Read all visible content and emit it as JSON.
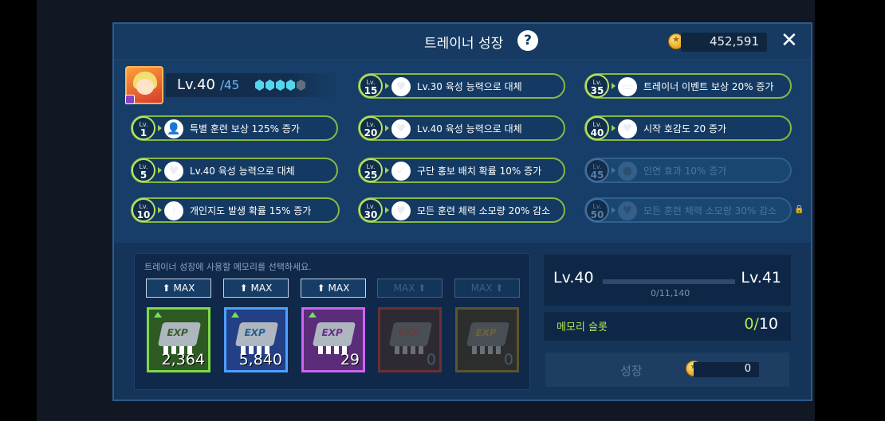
{
  "header": {
    "title": "트레이너 성장",
    "help_glyph": "?",
    "gold": "452,591",
    "close_glyph": "✕"
  },
  "trainer": {
    "level": "Lv.40",
    "max_level": "/45",
    "gems_filled": 4,
    "gems_total": 5
  },
  "perks": [
    {
      "lv_prefix": "Lv.",
      "lv": "1",
      "icon": "trainer-plus-icon",
      "glyph": "👤",
      "text": "특별 훈련 보상 125% 증가",
      "locked": false
    },
    {
      "lv_prefix": "Lv.",
      "lv": "5",
      "icon": "heart-icon",
      "glyph": "♥",
      "text": "Lv.40 육성 능력으로 대체",
      "locked": false
    },
    {
      "lv_prefix": "Lv.",
      "lv": "10",
      "icon": "alert-icon",
      "glyph": "!",
      "text": "개인지도 발생 확률 15% 증가",
      "locked": false
    },
    {
      "lv_prefix": "Lv.",
      "lv": "15",
      "icon": "broken-heart-icon",
      "glyph": "♥",
      "text": "Lv.30 육성 능력으로 대체",
      "locked": false
    },
    {
      "lv_prefix": "Lv.",
      "lv": "20",
      "icon": "heart-icon",
      "glyph": "♥",
      "text": "Lv.40 육성 능력으로 대체",
      "locked": false
    },
    {
      "lv_prefix": "Lv.",
      "lv": "25",
      "icon": "person-check-icon",
      "glyph": "✓",
      "text": "구단 홍보 배치 확률 10% 증가",
      "locked": false
    },
    {
      "lv_prefix": "Lv.",
      "lv": "30",
      "icon": "broken-heart-icon",
      "glyph": "♥",
      "text": "모든 훈련 체력 소모량 20% 감소",
      "locked": false
    },
    {
      "lv_prefix": "Lv.",
      "lv": "35",
      "icon": "chat-icon",
      "glyph": "▭",
      "text": "트레이너 이벤트 보상 20% 증가",
      "locked": false
    },
    {
      "lv_prefix": "Lv.",
      "lv": "40",
      "icon": "heart-icon",
      "glyph": "♥",
      "text": "시작 호감도 20 증가",
      "locked": false
    },
    {
      "lv_prefix": "Lv.",
      "lv": "45",
      "icon": "people-icon",
      "glyph": "●",
      "text": "인연 효과 10% 증가",
      "locked": true
    },
    {
      "lv_prefix": "Lv.",
      "lv": "50",
      "icon": "broken-heart-icon",
      "glyph": "♥",
      "text": "모든 훈련 체력 소모량 30% 감소",
      "locked": true
    }
  ],
  "memory": {
    "hint": "트레이너 성장에 사용할 메모리를 선택하세요.",
    "max_labels": [
      "⬆ MAX",
      "⬆ MAX",
      "⬆ MAX",
      "MAX ⬆",
      "MAX ⬆"
    ],
    "chip_label": "EXP",
    "counts": [
      "2,364",
      "5,840",
      "29",
      "0",
      "0"
    ]
  },
  "progress": {
    "cur_level": "Lv.40",
    "next_level": "Lv.41",
    "xp_text": "0/11,140",
    "xp_fraction": 0
  },
  "slot": {
    "label": "메모리 슬롯",
    "value": "0/",
    "max": "10"
  },
  "grow": {
    "label": "성장",
    "cost": "0"
  },
  "colors": {
    "accent_green": "#b4e64f",
    "panel": "#15345a"
  }
}
